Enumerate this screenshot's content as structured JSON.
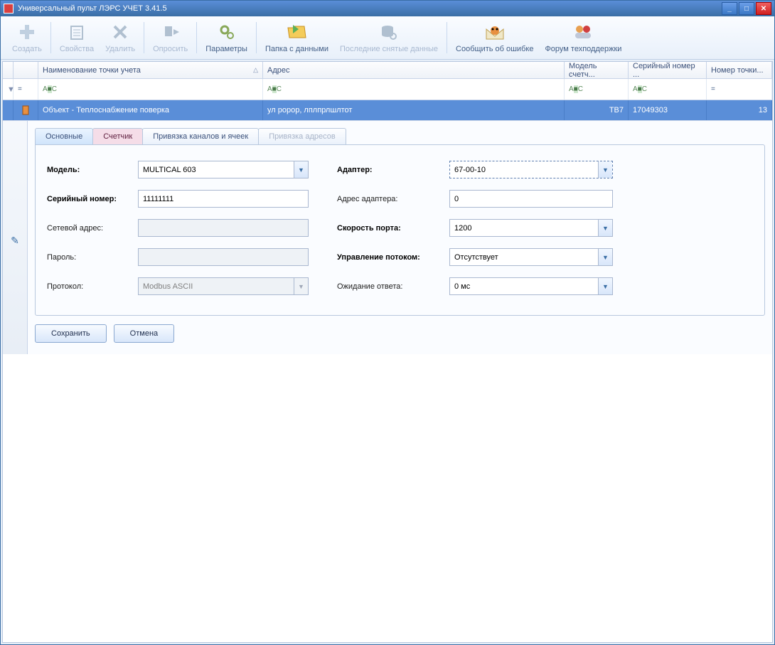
{
  "title": "Универсальный пульт ЛЭРС УЧЕТ 3.41.5",
  "toolbar": {
    "create": "Создать",
    "properties": "Свойства",
    "delete": "Удалить",
    "poll": "Опросить",
    "params": "Параметры",
    "datafolder": "Папка с данными",
    "lastdata": "Последние снятые данные",
    "reportbug": "Сообщить об ошибке",
    "forum": "Форум техподдержки"
  },
  "grid": {
    "cols": {
      "name": "Наименование точки учета",
      "address": "Адрес",
      "model": "Модель счетч...",
      "serial": "Серийный номер ...",
      "pointnum": "Номер точки..."
    },
    "filter_eq": "=",
    "filter_abc": "A■C",
    "row": {
      "name": "Объект - Теплоснабжение поверка",
      "address": "ул ророр, лплпрлшлтот",
      "model": "ТВ7",
      "serial": "17049303",
      "pointnum": "13"
    }
  },
  "tabs": {
    "t1": "Основные",
    "t2": "Счетчик",
    "t3": "Привязка каналов и ячеек",
    "t4": "Привязка адресов"
  },
  "form": {
    "model_label": "Модель:",
    "model_value": "MULTICAL 603",
    "serial_label": "Серийный номер:",
    "serial_value": "11111111",
    "netaddr_label": "Сетевой адрес:",
    "netaddr_value": "",
    "password_label": "Пароль:",
    "password_value": "",
    "protocol_label": "Протокол:",
    "protocol_value": "Modbus ASCII",
    "adapter_label": "Адаптер:",
    "adapter_value": "67-00-10",
    "adapter_addr_label": "Адрес адаптера:",
    "adapter_addr_value": "0",
    "portspeed_label": "Скорость порта:",
    "portspeed_value": "1200",
    "flowctrl_label": "Управление потоком:",
    "flowctrl_value": "Отсутствует",
    "timeout_label": "Ожидание ответа:",
    "timeout_value": "0 мс"
  },
  "buttons": {
    "save": "Сохранить",
    "cancel": "Отмена"
  }
}
